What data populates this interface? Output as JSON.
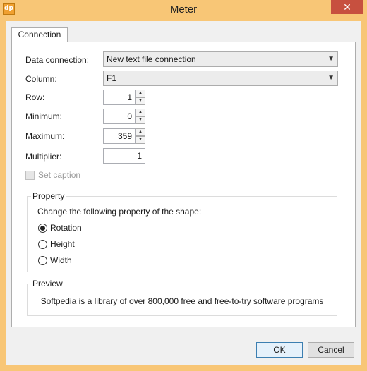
{
  "window": {
    "title": "Meter",
    "app_icon_text": "dp",
    "close_glyph": "✕"
  },
  "tabs": [
    {
      "label": "Connection",
      "selected": true
    }
  ],
  "form": {
    "data_connection": {
      "label": "Data connection:",
      "value": "New text file connection"
    },
    "column": {
      "label": "Column:",
      "value": "F1"
    },
    "row": {
      "label": "Row:",
      "value": "1"
    },
    "minimum": {
      "label": "Minimum:",
      "value": "0"
    },
    "maximum": {
      "label": "Maximum:",
      "value": "359"
    },
    "multiplier": {
      "label": "Multiplier:",
      "value": "1"
    },
    "set_caption": {
      "label": "Set caption",
      "checked": false,
      "enabled": false
    }
  },
  "property": {
    "group_title": "Property",
    "instruction": "Change the following property of  the shape:",
    "options": [
      {
        "label": "Rotation",
        "checked": true
      },
      {
        "label": "Height",
        "checked": false
      },
      {
        "label": "Width",
        "checked": false
      }
    ]
  },
  "preview": {
    "group_title": "Preview",
    "text": "Softpedia is a library of over 800,000 free and free-to-try software programs"
  },
  "buttons": {
    "ok": "OK",
    "cancel": "Cancel"
  },
  "icons": {
    "dropdown": "chevron-down-icon",
    "spin_up": "spin-up-icon",
    "spin_down": "spin-down-icon"
  },
  "colors": {
    "frame": "#f8c676",
    "close_button": "#c7503f",
    "default_button_border": "#3c7fb1"
  }
}
